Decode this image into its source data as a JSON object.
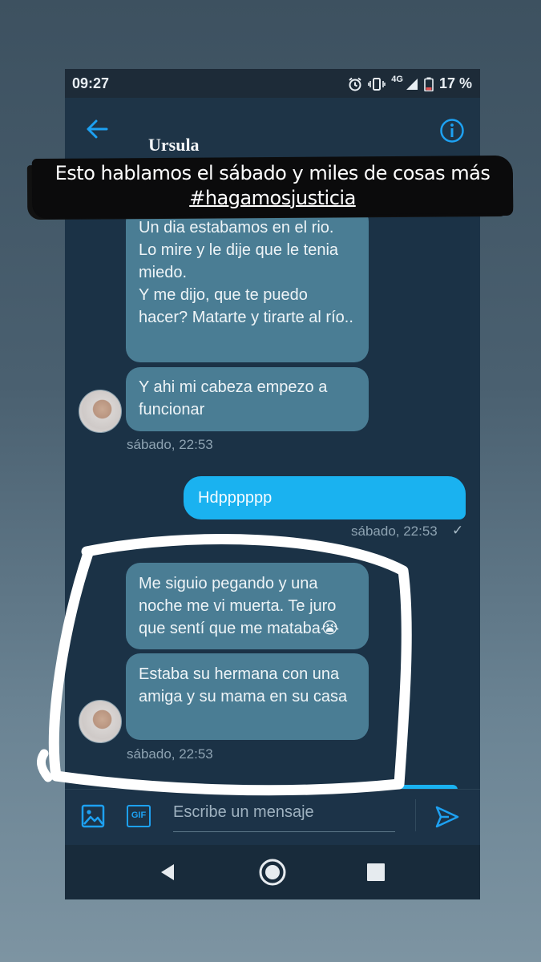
{
  "status_bar": {
    "time": "09:27",
    "network": "4G",
    "battery": "17 %",
    "icons": [
      "alarm-icon",
      "vibrate-icon",
      "signal-icon",
      "battery-icon"
    ]
  },
  "header": {
    "contact_name": "Ursula",
    "back_icon": "arrow-left-icon",
    "info_icon": "info-icon"
  },
  "caption": {
    "line1": "Esto hablamos el sábado y miles de cosas más",
    "line2": "#hagamosjusticia"
  },
  "messages": [
    {
      "id": "m1",
      "direction": "incoming",
      "text": "Un dia estabamos en el rio.\nLo mire y le dije que le tenia miedo.\nY me dijo, que te puedo hacer? Matarte y tirarte al río.."
    },
    {
      "id": "m2",
      "direction": "incoming",
      "text": "Y ahi mi cabeza empezo a funcionar"
    },
    {
      "id": "ts1",
      "text": "sábado, 22:53"
    },
    {
      "id": "m3",
      "direction": "outgoing",
      "text": "Hdpppppp"
    },
    {
      "id": "ts2",
      "text": "sábado, 22:53",
      "read_check": "✓"
    },
    {
      "id": "m4",
      "direction": "incoming",
      "text": "Me siguio pegando y una noche me vi muerta. Te juro que sentí que me mataba😭"
    },
    {
      "id": "m5",
      "direction": "incoming",
      "text": "Estaba su hermana con una amiga y su mama en su casa"
    },
    {
      "id": "ts3",
      "text": "sábado, 22:53"
    }
  ],
  "composer": {
    "placeholder": "Escribe un mensaje",
    "gif_label": "GIF",
    "image_icon": "image-icon",
    "send_icon": "send-icon"
  },
  "navigation": {
    "icons": [
      "back-triangle-icon",
      "home-circle-icon",
      "recents-square-icon"
    ]
  },
  "colors": {
    "chat_bg": "#1b3246",
    "incoming_bubble": "#4a7d94",
    "outgoing_bubble": "#1ab2f0",
    "accent": "#1da1f2",
    "highlight_stroke": "#ffffff"
  }
}
